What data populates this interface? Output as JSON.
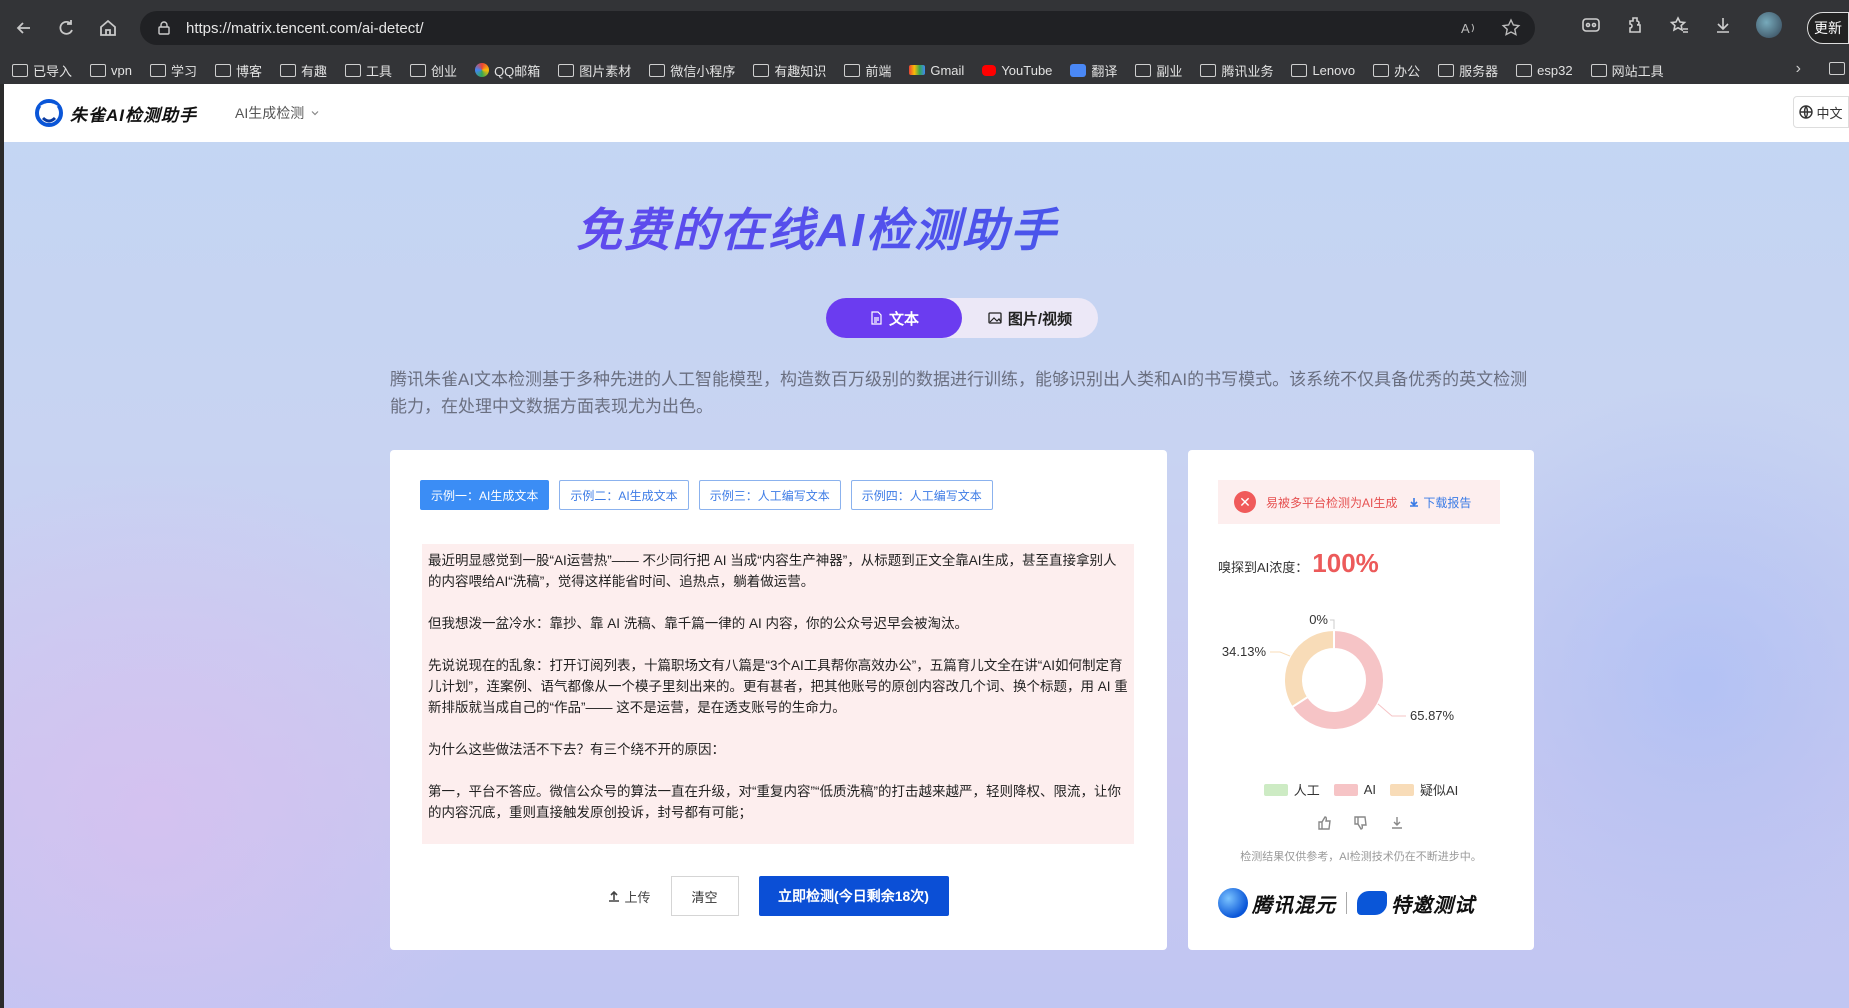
{
  "browser": {
    "url": "https://matrix.tencent.com/ai-detect/",
    "update_label": "更新",
    "bookmarks": [
      "已导入",
      "vpn",
      "学习",
      "博客",
      "有趣",
      "工具",
      "创业",
      "QQ邮箱",
      "图片素材",
      "微信小程序",
      "有趣知识",
      "前端",
      "Gmail",
      "YouTube",
      "翻译",
      "副业",
      "腾讯业务",
      "Lenovo",
      "办公",
      "服务器",
      "esp32",
      "网站工具"
    ]
  },
  "header": {
    "logo_text": "朱雀AI检测助手",
    "nav_item": "AI生成检测",
    "lang": "中文"
  },
  "hero": {
    "title": "免费的在线AI检测助手",
    "tab_text": "文本",
    "tab_image": "图片/视频",
    "description": "腾讯朱雀AI文本检测基于多种先进的人工智能模型，构造数百万级别的数据进行训练，能够识别出人类和AI的书写模式。该系统不仅具备优秀的英文检测能力，在处理中文数据方面表现尤为出色。"
  },
  "editor": {
    "examples": [
      "示例一：AI生成文本",
      "示例二：AI生成文本",
      "示例三：人工编写文本",
      "示例四：人工编写文本"
    ],
    "paragraphs": [
      "最近明显感觉到一股“AI运营热”—— 不少同行把 AI 当成“内容生产神器”，从标题到正文全靠AI生成，甚至直接拿别人的内容喂给AI“洗稿”，觉得这样能省时间、追热点，躺着做运营。",
      "但我想泼一盆冷水：靠抄、靠 AI 洗稿、靠千篇一律的 AI 内容，你的公众号迟早会被淘汰。",
      "先说说现在的乱象：打开订阅列表，十篇职场文有八篇是“3个AI工具帮你高效办公”，五篇育儿文全在讲“AI如何制定育儿计划”，连案例、语气都像从一个模子里刻出来的。更有甚者，把其他账号的原创内容改几个词、换个标题，用 AI 重新排版就当成自己的“作品”—— 这不是运营，是在透支账号的生命力。",
      "为什么这些做法活不下去？有三个绕不开的原因：",
      "第一，平台不答应。微信公众号的算法一直在升级，对“重复内容”“低质洗稿”的打击越来越严，轻则降权、限流，让你的内容沉底，重则直接触发原创投诉，封号都有可能；"
    ],
    "upload_label": "上传",
    "clear_label": "清空",
    "detect_label": "立即检测(今日剩余18次)"
  },
  "result": {
    "warning": "易被多平台检测为AI生成",
    "download_label": "下载报告",
    "score_label": "嗅探到AI浓度：",
    "score_value": "100%",
    "disclaimer": "检测结果仅供参考，AI检测技术仍在不断进步中。",
    "partner1": "腾讯混元",
    "partner2": "特邀测试"
  },
  "chart_data": {
    "type": "pie",
    "categories": [
      "人工",
      "AI",
      "疑似AI"
    ],
    "values": [
      0,
      65.87,
      34.13
    ],
    "labels": [
      "0%",
      "65.87%",
      "34.13%"
    ],
    "colors": [
      "#cdebc4",
      "#f6c4c6",
      "#f8dcb8"
    ]
  }
}
